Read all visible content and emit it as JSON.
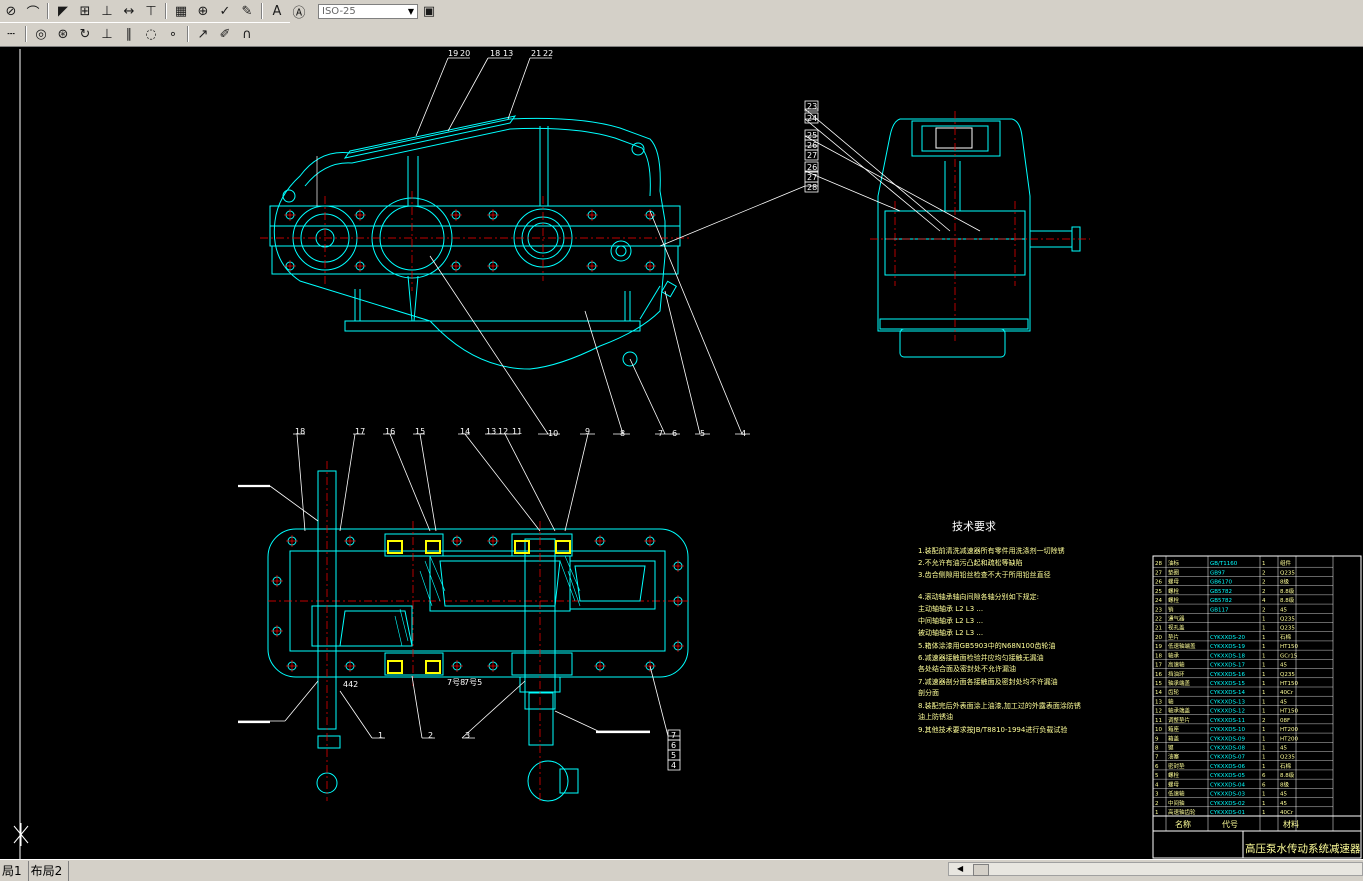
{
  "toolbar": {
    "row1_icons": [
      "zoom-all-icon",
      "measure-icon",
      "snap-icon",
      "table-icon",
      "align-icon",
      "dimension-icon",
      "dim-tree-icon",
      "grid-icon",
      "center-mark-icon",
      "check-icon",
      "pen-icon",
      "text-icon",
      "edit-text-icon",
      "style-icon"
    ],
    "style_combo": "ISO-25",
    "row2_icons": [
      "dash-icon",
      "circle-dot-icon",
      "target-icon",
      "rotate-icon",
      "perpendicular-icon",
      "parallel-icon",
      "group-icon",
      "point-icon",
      "stretch-icon",
      "edit-pen-icon",
      "magnet-icon"
    ]
  },
  "drawing": {
    "callouts_top": [
      "19",
      "20",
      "18",
      "13",
      "21",
      "22"
    ],
    "callouts_right": [
      "23",
      "24",
      "25",
      "26",
      "27",
      "26",
      "27",
      "28"
    ],
    "callouts_mid": [
      "10",
      "8",
      "7",
      "6",
      "5",
      "4"
    ],
    "callouts_plan_top": [
      "18",
      "17",
      "16",
      "15",
      "14",
      "13",
      "12",
      "11",
      "9"
    ],
    "callouts_plan_bottom": [
      "1",
      "2",
      "3"
    ],
    "callouts_plan_right": [
      "7",
      "6",
      "5",
      "4"
    ],
    "dims": [
      "442",
      "7号8",
      "7号5"
    ],
    "tech_title": "技术要求",
    "tech_lines": [
      "1.装配前清洗减速器所有零件用洗涤剂一切除锈",
      "2.不允许有油污凸起和疏松等缺陷",
      "3.齿合侧隙用铅丝检查不大于所用铅丝直径",
      "4.滚动轴承轴向间隙各轴分别如下规定:",
      "   主动轴轴承 L2  L3 ...",
      "   中间轴轴承 L2  L3 ...",
      "   被动轴轴承 L2  L3 ...",
      "5.箱体涂漆用GB5903中的N68N100齿轮油",
      "6.减速器接触面检验并应均匀接触无漏油",
      "  各处结合面及密封处不允许漏油",
      "7.减速器剖分面各接触面及密封处均不许漏油",
      "  剖分面",
      "8.装配完后外表面涂上油漆,加工过的外露表面涂防锈",
      "  油上防锈油",
      "9.其他技术要求按JB/T8810-1994进行负载试验"
    ],
    "title_block": {
      "name_header": "名称",
      "code_header": "代号",
      "material_header": "材料",
      "drawing_title": "高压泵水传动系统减速器",
      "rows": [
        [
          "28",
          "油标",
          "GB/T1160",
          "1",
          "组件"
        ],
        [
          "27",
          "垫圈",
          "GB97",
          "2",
          "Q235"
        ],
        [
          "26",
          "螺母",
          "GB6170",
          "2",
          "8级"
        ],
        [
          "25",
          "螺栓",
          "GB5782",
          "2",
          "8.8级"
        ],
        [
          "24",
          "螺栓",
          "GB5782",
          "4",
          "8.8级"
        ],
        [
          "23",
          "销",
          "GB117",
          "2",
          "45"
        ],
        [
          "22",
          "通气器",
          "",
          "1",
          "Q235"
        ],
        [
          "21",
          "视孔盖",
          "",
          "1",
          "Q235"
        ],
        [
          "20",
          "垫片",
          "CYKXXDS-20",
          "1",
          "石棉"
        ],
        [
          "19",
          "低速轴端盖",
          "CYKXXDS-19",
          "1",
          "HT150"
        ],
        [
          "18",
          "轴承",
          "CYKXXDS-18",
          "1",
          "GCr15"
        ],
        [
          "17",
          "高速轴",
          "CYKXXDS-17",
          "1",
          "45"
        ],
        [
          "16",
          "挡油环",
          "CYKXXDS-16",
          "1",
          "Q235"
        ],
        [
          "15",
          "轴承端盖",
          "CYKXXDS-15",
          "1",
          "HT150"
        ],
        [
          "14",
          "齿轮",
          "CYKXXDS-14",
          "1",
          "40Cr"
        ],
        [
          "13",
          "轴",
          "CYKXXDS-13",
          "1",
          "45"
        ],
        [
          "12",
          "轴承端盖",
          "CYKXXDS-12",
          "1",
          "HT150"
        ],
        [
          "11",
          "调整垫片",
          "CYKXXDS-11",
          "2",
          "08F"
        ],
        [
          "10",
          "箱座",
          "CYKXXDS-10",
          "1",
          "HT200"
        ],
        [
          "9",
          "箱盖",
          "CYKXXDS-09",
          "1",
          "HT200"
        ],
        [
          "8",
          "键",
          "CYKXXDS-08",
          "1",
          "45"
        ],
        [
          "7",
          "油塞",
          "CYKXXDS-07",
          "1",
          "Q235"
        ],
        [
          "6",
          "密封垫",
          "CYKXXDS-06",
          "1",
          "石棉"
        ],
        [
          "5",
          "螺栓",
          "CYKXXDS-05",
          "6",
          "8.8级"
        ],
        [
          "4",
          "螺母",
          "CYKXXDS-04",
          "6",
          "8级"
        ],
        [
          "3",
          "低速轴",
          "CYKXXDS-03",
          "1",
          "45"
        ],
        [
          "2",
          "中间轴",
          "CYKXXDS-02",
          "1",
          "45"
        ],
        [
          "1",
          "高速轴齿轮",
          "CYKXXDS-01",
          "1",
          "40Cr"
        ]
      ]
    }
  },
  "layout_tabs": [
    "局1",
    "布局2"
  ],
  "colors": {
    "canvas_bg": "#000000",
    "line_cyan": "#00ffff",
    "center_red": "#ff0000",
    "leader_white": "#ffffff",
    "highlight_yellow": "#ffff00",
    "text_yellow": "#ffff99",
    "toolbar_bg": "#d4d0c8"
  }
}
